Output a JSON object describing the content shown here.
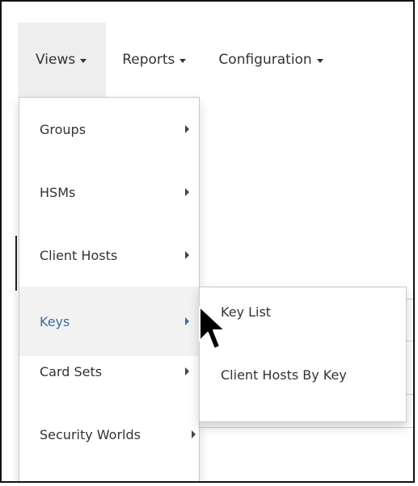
{
  "nav": {
    "items": [
      {
        "label": "Views",
        "active": true
      },
      {
        "label": "Reports",
        "active": false
      },
      {
        "label": "Configuration",
        "active": false
      }
    ]
  },
  "views_menu": {
    "items": [
      {
        "label": "Groups",
        "active": false
      },
      {
        "label": "HSMs",
        "active": false
      },
      {
        "label": "Client Hosts",
        "active": false
      },
      {
        "label": "Keys",
        "active": true
      },
      {
        "label": "Card Sets",
        "active": false
      },
      {
        "label": "Security Worlds",
        "active": false
      }
    ]
  },
  "keys_submenu": {
    "items": [
      {
        "label": "Key List"
      },
      {
        "label": "Client Hosts By Key"
      }
    ]
  },
  "icons": {
    "submenu_arrow": "chevron-right-icon",
    "dropdown_caret": "caret-down-icon",
    "cursor": "mouse-pointer-icon"
  },
  "colors": {
    "active_text": "#3c6da3",
    "active_bg": "#f2f2f2",
    "nav_active_bg": "#eeeeee"
  }
}
